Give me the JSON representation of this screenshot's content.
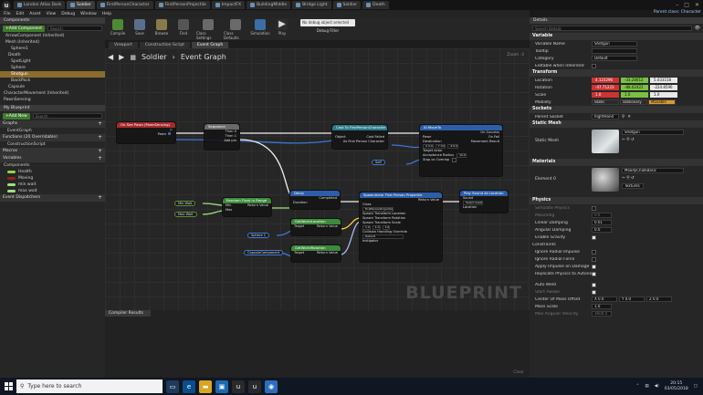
{
  "window": {
    "tabs": [
      "London Atlas Dark",
      "Soldier",
      "FirstPersonCharacter",
      "FirstPersonProjectile",
      "ImpactFX",
      "BuildingMiddle",
      "Bridge Light",
      "Soldier",
      "Death"
    ],
    "active_tab_index": 1,
    "project_label": "Parent class: Character"
  },
  "menu": [
    "File",
    "Edit",
    "Asset",
    "View",
    "Debug",
    "Window",
    "Help"
  ],
  "toolbar": {
    "buttons": [
      "Compile",
      "Save",
      "Browse",
      "Find",
      "Class Settings",
      "Class Defaults",
      "Simulation",
      "Play"
    ],
    "debug_selection": "No debug object selected",
    "debug_filter": "Debug Filter"
  },
  "components_panel": {
    "tab": "Components",
    "add_button": "+Add Component",
    "search_placeholder": "Search",
    "items": [
      "ArrowComponent (Inherited)",
      "Mesh (Inherited)",
      "Sphere1",
      "Death",
      "SpotLight",
      "Sphere",
      "Shotgun",
      "BackPack",
      "Capsule",
      "CharacterMovement (Inherited)",
      "PawnSensing"
    ],
    "selected_index": 6
  },
  "mybp_panel": {
    "tab": "My Blueprint",
    "add_button": "+Add New",
    "search_placeholder": "Search",
    "graphs_label": "Graphs",
    "graphs": [
      "EventGraph"
    ],
    "functions_label": "Functions (20 Overridable)",
    "functions": [
      "ConstructionScript"
    ],
    "macros_label": "Macros",
    "variables_label": "Variables",
    "components_label": "Components",
    "variables": [
      {
        "name": "Health",
        "color": "#8fd44f"
      },
      {
        "name": "Moving",
        "color": "#9b1d1d"
      },
      {
        "name": "min wait",
        "color": "#9ee27a"
      },
      {
        "name": "max wait",
        "color": "#9ee27a"
      }
    ],
    "dispatchers_label": "Event Dispatchers"
  },
  "view_tabs": [
    "Viewport",
    "Construction Script",
    "Event Graph"
  ],
  "active_view_tab": 2,
  "graph": {
    "breadcrumb_root": "Soldier",
    "breadcrumb_leaf": "Event Graph",
    "zoom": "Zoom -3",
    "watermark": "BLUEPRINT",
    "nodes": {
      "event": {
        "title": "On See Pawn (PawnSensing)",
        "pin": "Pawn"
      },
      "sequence": {
        "title": "Sequence",
        "pins": [
          "Then 0",
          "Then 1",
          "Add pin"
        ]
      },
      "cast": {
        "title": "Cast To FirstPersonCharacter",
        "pins": [
          "Object",
          "Cast Failed",
          "As First Person Character"
        ]
      },
      "ai_move": {
        "title": "AI MoveTo",
        "pins": [
          "Pawn",
          "Destination",
          "Target Actor",
          "Acceptance Radius",
          "Stop on Overlap",
          "On Success",
          "On Fail",
          "Movement Result"
        ],
        "dest_values": [
          "X 0.0",
          "Y 0.0",
          "Z 0.0"
        ],
        "radius": "10.0"
      },
      "self_ref": {
        "label": "Self"
      },
      "delay": {
        "title": "Delay",
        "pins": [
          "Duration",
          "Completed"
        ]
      },
      "random": {
        "title": "Random Float in Range",
        "pins": [
          "Min",
          "Max",
          "Return Value"
        ]
      },
      "min_get": {
        "label": "Min Wait"
      },
      "max_get": {
        "label": "Max Wait"
      },
      "spawn": {
        "title": "SpawnActor First Person Projectile",
        "pins": [
          "Class",
          "Spawn Transform Location",
          "Spawn Transform Rotation",
          "Spawn Transform Scale",
          "Collision Handling Override",
          "Instigator",
          "Return Value"
        ],
        "class_value": "FirstPersonProjectile",
        "scale": [
          "1.0",
          "1.0",
          "1.0"
        ],
        "collision": "Default"
      },
      "get_loc": {
        "title": "GetWorldLocation",
        "pins": [
          "Target",
          "Return Value"
        ]
      },
      "get_rot": {
        "title": "GetWorldRotation",
        "pins": [
          "Target",
          "Return Value"
        ]
      },
      "sphere_get": {
        "label": "Sphere 1"
      },
      "capsule_get": {
        "label": "CapsuleComponent"
      },
      "sound": {
        "title": "Play Sound At Location",
        "pins": [
          "Sound",
          "Location"
        ],
        "sound_value": "Select Asset"
      }
    }
  },
  "compiler": {
    "tab": "Compiler Results",
    "clear": "Clear"
  },
  "details": {
    "tab": "Details",
    "search_placeholder": "Search Details",
    "variable_label": "Variable",
    "variable_rows": [
      {
        "label": "Variable Name",
        "value": "Shotgun"
      },
      {
        "label": "Tooltip",
        "value": ""
      },
      {
        "label": "Category",
        "value": "Default"
      },
      {
        "label": "Editable when Inherited",
        "value": ""
      }
    ],
    "transform_label": "Transform",
    "location": {
      "label": "Location",
      "x": "4.123296",
      "y": "-33.28012",
      "z": "5.033158"
    },
    "rotation": {
      "label": "Rotation",
      "x": "-47.71223",
      "y": "-88.02422",
      "z": "-224.8596"
    },
    "scale": {
      "label": "Scale",
      "x": "1.0",
      "y": "1.0",
      "z": "1.0"
    },
    "mobility": {
      "label": "Mobility",
      "options": [
        "Static",
        "Stationary",
        "Movable"
      ],
      "selected": "Movable"
    },
    "sockets_label": "Sockets",
    "parent_socket": {
      "label": "Parent Socket",
      "value": "RightHand"
    },
    "static_mesh_label": "Static Mesh",
    "static_mesh": {
      "label": "Static Mesh",
      "value": "Shotgun"
    },
    "materials_label": "Materials",
    "material": {
      "label": "Element 0",
      "value": "MoodyChalkBasic",
      "source": "Textures"
    },
    "physics_label": "Physics",
    "physics_rows": [
      {
        "label": "Simulate Physics",
        "type": "check",
        "on": false,
        "dim": true
      },
      {
        "label": "MassInKg",
        "type": "field",
        "value": "0.0",
        "dim": true
      },
      {
        "label": "Linear Damping",
        "type": "field",
        "value": "0.01"
      },
      {
        "label": "Angular Damping",
        "type": "field",
        "value": "0.0"
      },
      {
        "label": "Enable Gravity",
        "type": "check",
        "on": true
      }
    ],
    "constraints_label": "Constraints",
    "constraint_rows": [
      {
        "label": "Ignore Radial Impulse",
        "on": false
      },
      {
        "label": "Ignore Radial Force",
        "on": false
      },
      {
        "label": "Apply Impulse on Damage",
        "on": true
      },
      {
        "label": "Replicate Physics to Autonomous Proxy",
        "on": true
      }
    ],
    "misc_rows": [
      {
        "label": "Auto Weld",
        "type": "check",
        "on": true
      },
      {
        "label": "Start Awake",
        "type": "check",
        "on": true,
        "dim": true
      }
    ],
    "com_offset": {
      "label": "Center Of Mass Offset",
      "x": "X 0.0",
      "y": "Y 0.0",
      "z": "Z 0.0"
    },
    "mass_scale": {
      "label": "Mass Scale",
      "value": "1.0"
    },
    "max_angular": {
      "label": "Max Angular Velocity",
      "value": "3600.0"
    }
  },
  "taskbar": {
    "search_placeholder": "Type here to search",
    "time": "20:15",
    "date": "03/05/2018"
  }
}
